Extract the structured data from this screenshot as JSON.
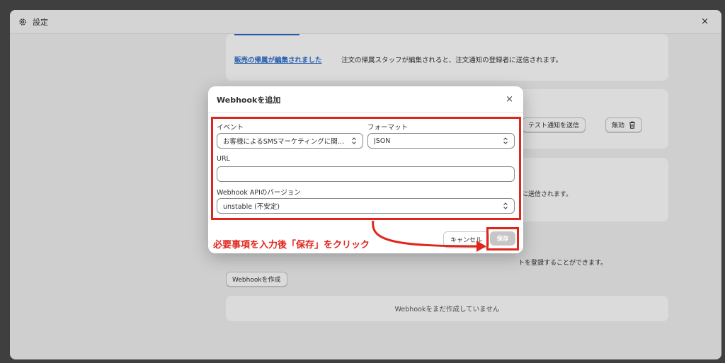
{
  "window": {
    "title": "設定",
    "close": "×"
  },
  "background": {
    "link_text": "販売の帰属が編集されました",
    "link_desc": "注文の帰属スタッフが編集されると、注文通知の登録者に送信されます。",
    "test_button": "テスト通知を送信",
    "disable_button": "無効",
    "card3_text": "に送信されます。",
    "section_text": "トを登録することができます。",
    "create_button": "Webhookを作成",
    "empty_state": "Webhookをまだ作成していません"
  },
  "modal": {
    "title": "Webhookを追加",
    "close": "×",
    "event_label": "イベント",
    "event_value": "お客様によるSMSマーケティングに関する同意の更新",
    "format_label": "フォーマット",
    "format_value": "JSON",
    "url_label": "URL",
    "url_value": "",
    "version_label": "Webhook APIのバージョン",
    "version_value": "unstable (不安定)",
    "cancel": "キャンセル",
    "save": "保存"
  },
  "annotation": "必要事項を入力後「保存」をクリック",
  "colors": {
    "annotation_red": "#e0261c",
    "link_blue": "#2c6ecb"
  }
}
